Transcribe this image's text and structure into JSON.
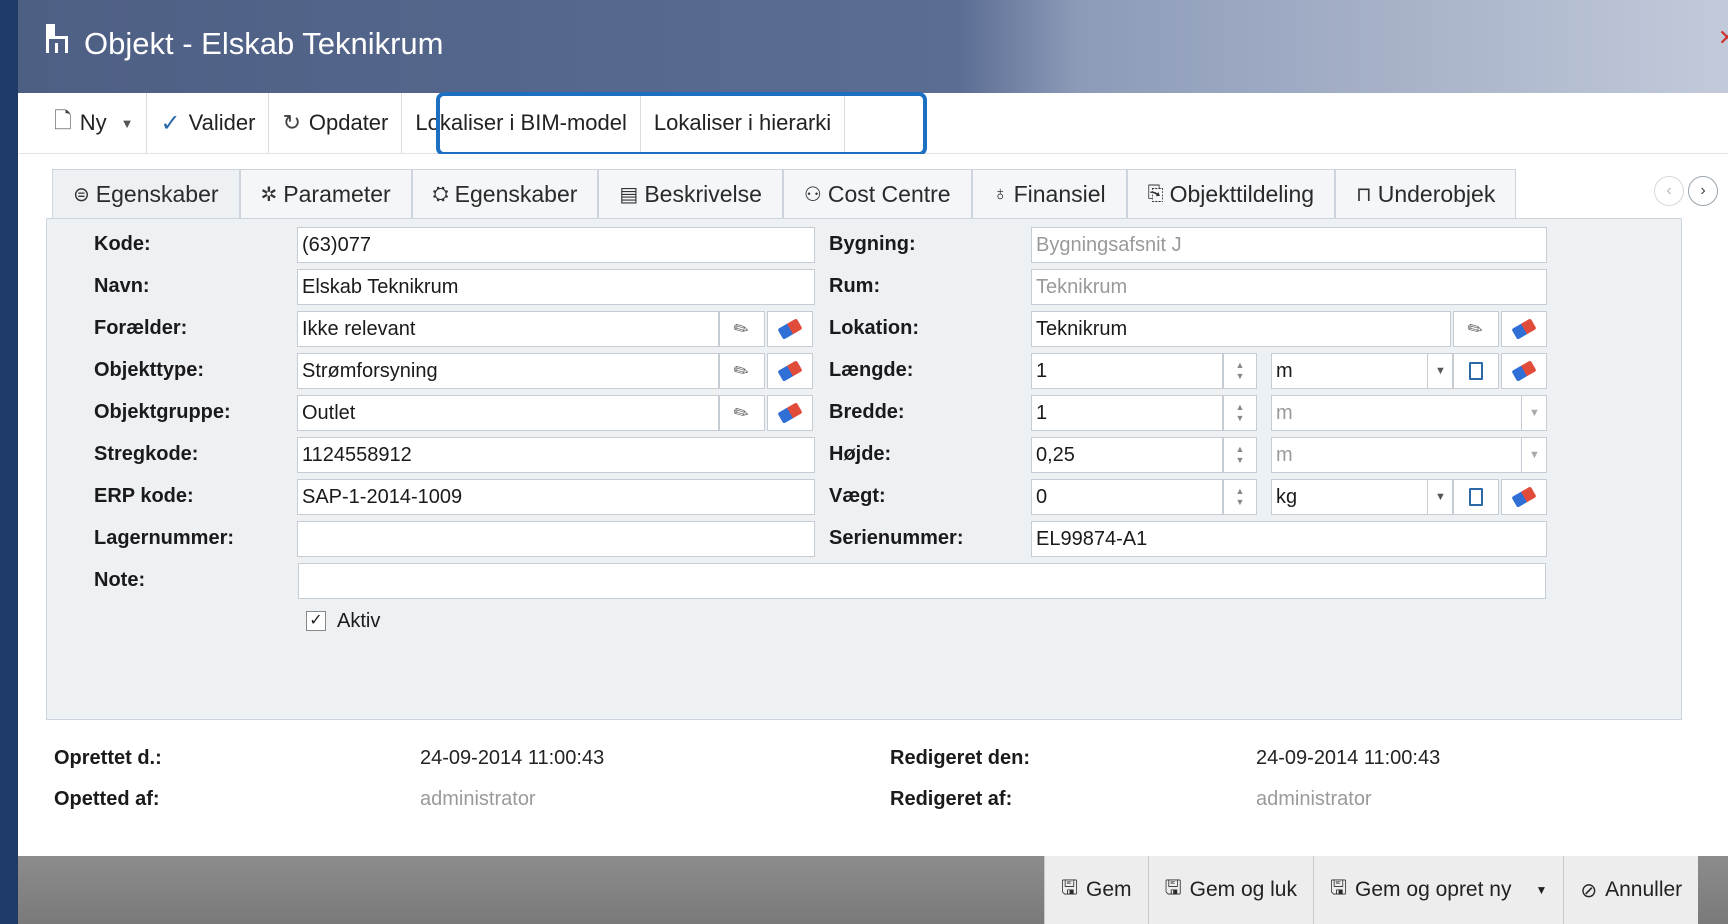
{
  "window": {
    "title": "Objekt - Elskab Teknikrum"
  },
  "toolbar": {
    "new_label": "Ny",
    "validate_label": "Valider",
    "refresh_label": "Opdater",
    "locate_bim_label": "Lokaliser i BIM-model",
    "locate_hierarchy_label": "Lokaliser i hierarki"
  },
  "tabs": [
    {
      "label": "Egenskaber",
      "icon": "properties-icon"
    },
    {
      "label": "Parameter",
      "icon": "gear-icon"
    },
    {
      "label": "Egenskaber",
      "icon": "tag-icon"
    },
    {
      "label": "Beskrivelse",
      "icon": "document-icon"
    },
    {
      "label": "Cost Centre",
      "icon": "people-icon"
    },
    {
      "label": "Finansiel",
      "icon": "money-bag-icon"
    },
    {
      "label": "Objekttildeling",
      "icon": "assign-icon"
    },
    {
      "label": "Underobjek",
      "icon": "subobject-icon"
    }
  ],
  "form": {
    "kode": {
      "label": "Kode:",
      "value": "(63)077"
    },
    "navn": {
      "label": "Navn:",
      "value": "Elskab Teknikrum"
    },
    "foraelder": {
      "label": "Forælder:",
      "value": "Ikke relevant"
    },
    "objekttype": {
      "label": "Objekttype:",
      "value": "Strømforsyning"
    },
    "objektgruppe": {
      "label": "Objektgruppe:",
      "value": "Outlet"
    },
    "stregkode": {
      "label": "Stregkode:",
      "value": "1124558912"
    },
    "erp": {
      "label": "ERP kode:",
      "value": "SAP-1-2014-1009"
    },
    "lager": {
      "label": "Lagernummer:",
      "value": ""
    },
    "note": {
      "label": "Note:",
      "value": ""
    },
    "aktiv": {
      "label": "Aktiv",
      "checked": true
    },
    "bygning": {
      "label": "Bygning:",
      "value": "Bygningsafsnit J"
    },
    "rum": {
      "label": "Rum:",
      "value": "Teknikrum"
    },
    "lokation": {
      "label": "Lokation:",
      "value": "Teknikrum"
    },
    "laengde": {
      "label": "Længde:",
      "value": "1",
      "unit": "m"
    },
    "bredde": {
      "label": "Bredde:",
      "value": "1",
      "unit": "m"
    },
    "hojde": {
      "label": "Højde:",
      "value": "0,25",
      "unit": "m"
    },
    "vaegt": {
      "label": "Vægt:",
      "value": "0",
      "unit": "kg"
    },
    "serie": {
      "label": "Serienummer:",
      "value": "EL99874-A1"
    }
  },
  "meta": {
    "created_label": "Oprettet d.:",
    "created_value": "24-09-2014 11:00:43",
    "created_by_label": "Opetted af:",
    "created_by_value": "administrator",
    "edited_label": "Redigeret den:",
    "edited_value": "24-09-2014 11:00:43",
    "edited_by_label": "Redigeret af:",
    "edited_by_value": "administrator"
  },
  "footer": {
    "save_label": "Gem",
    "save_close_label": "Gem og luk",
    "save_new_label": "Gem og opret ny",
    "cancel_label": "Annuller"
  },
  "colors": {
    "highlight": "#1d6fc2",
    "title_bar": "#4e5f84",
    "footer": "#7a7a7a"
  }
}
